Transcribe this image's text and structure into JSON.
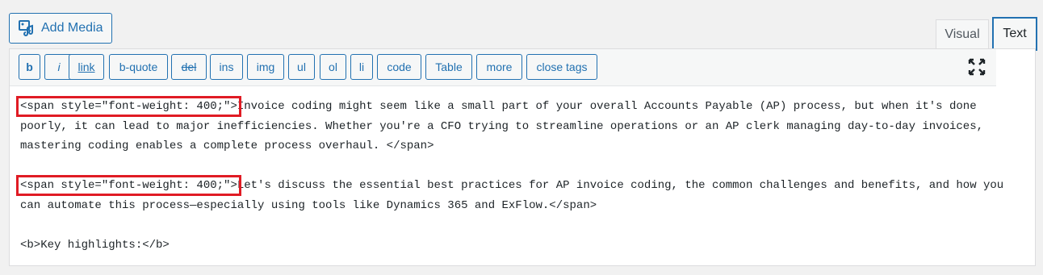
{
  "add_media": {
    "label": "Add Media",
    "icon": "add-media-icon"
  },
  "tabs": {
    "visual": "Visual",
    "text": "Text"
  },
  "toolbar": {
    "buttons": [
      "b",
      "i",
      "link",
      "b-quote",
      "del",
      "ins",
      "img",
      "ul",
      "ol",
      "li",
      "code",
      "Table",
      "more",
      "close tags"
    ],
    "fullscreen_icon": "fullscreen-icon"
  },
  "content": {
    "p1": {
      "tag": "<span style=\"font-weight: 400;\">",
      "text": "Invoice coding might seem like a small part of your overall Accounts Payable (AP) process, but when it's done poorly, it can lead to major inefficiencies. Whether you're a CFO trying to streamline operations or an AP clerk managing day-to-day invoices, mastering coding enables a complete process overhaul. </span>"
    },
    "p2": {
      "tag": "<span style=\"font-weight: 400;\">",
      "text": "Let's discuss the essential best practices for AP invoice coding, the common challenges and benefits, and how you can automate this process—especially using tools like Dynamics 365 and ExFlow.</span>"
    },
    "p3": "<b>Key highlights:</b>"
  },
  "colors": {
    "accent": "#2271b1",
    "highlight": "#e01b24",
    "text": "#1d2327"
  }
}
